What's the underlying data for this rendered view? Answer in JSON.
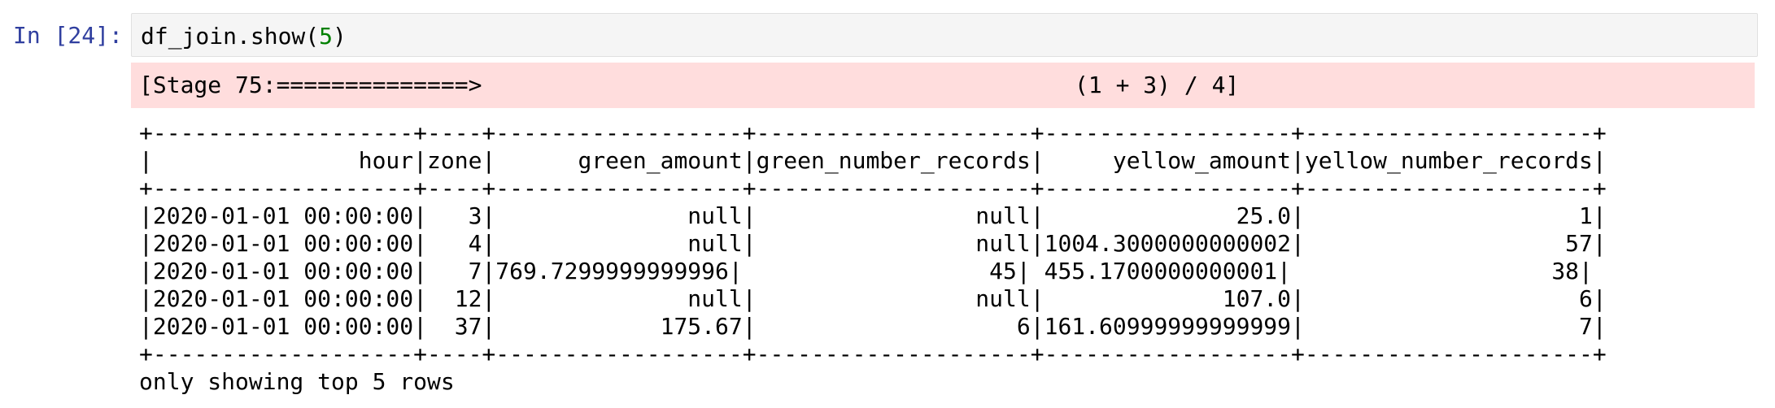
{
  "cell": {
    "prompt": "In [24]:",
    "code_prefix": "df_join.show(",
    "code_arg": "5",
    "code_suffix": ")"
  },
  "stderr": {
    "progress": "[Stage 75:==============>",
    "count": "(1 + 3) / 4]"
  },
  "output": {
    "lines": [
      "+-------------------+----+------------------+--------------------+------------------+---------------------+",
      "|               hour|zone|      green_amount|green_number_records|     yellow_amount|yellow_number_records|",
      "+-------------------+----+------------------+--------------------+------------------+---------------------+",
      "|2020-01-01 00:00:00|   3|              null|                null|              25.0|                    1|",
      "|2020-01-01 00:00:00|   4|              null|                null|1004.3000000000002|                   57|",
      "|2020-01-01 00:00:00|   7|769.7299999999996|                  45| 455.1700000000001|                   38|",
      "|2020-01-01 00:00:00|  12|              null|                null|             107.0|                    6|",
      "|2020-01-01 00:00:00|  37|            175.67|                   6|161.60999999999999|                    7|",
      "+-------------------+----+------------------+--------------------+------------------+---------------------+",
      "only showing top 5 rows"
    ]
  }
}
